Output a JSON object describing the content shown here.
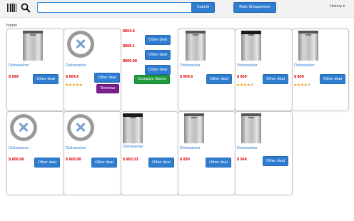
{
  "header": {
    "search_value": "",
    "submit_label": "Submit",
    "rate_label": "Rate Shoppertore",
    "history_label": "History",
    "icons": [
      "barcode-icon",
      "search-icon",
      "chevron-down-icon"
    ]
  },
  "found_label": "found:",
  "row1": [
    {
      "name": "Dishwasher",
      "price": "$ 699",
      "deal": "Other deal"
    },
    {
      "name": "Dishwasher",
      "price": "$ 804.6",
      "deal": "Other deal",
      "reviews": "Reviews",
      "stores": [
        {
          "price": "$804.6",
          "deal": "Other deal"
        },
        {
          "price": "$809.1",
          "deal": "Other deal"
        },
        {
          "price": "$809.98",
          "deal": "Other deal"
        }
      ],
      "compare": "Compare Stores"
    },
    {
      "name": "Dishwasher",
      "price": "$ 804.6",
      "deal": "Other deal"
    },
    {
      "name": "Dishwasher",
      "price": "$ 809",
      "deal": "Other deal"
    },
    {
      "name": "Dishwasher",
      "price": "$ 809",
      "deal": "Other deal"
    }
  ],
  "row2": [
    {
      "name": "Dishwasher",
      "price": "$ 809.98",
      "deal": "Other deal"
    },
    {
      "name": "Dishwasher",
      "price": "$ 809.98",
      "deal": "Other deal"
    },
    {
      "name": "Dishwasher",
      "price": "$ 850.33",
      "deal": "Other deal"
    },
    {
      "name": "Dishwasher",
      "price": "$ 899",
      "deal": "Other deal"
    },
    {
      "name": "Dishwasher",
      "price": "$ 949",
      "deal": "Other deal"
    }
  ],
  "ratings": {
    "row1_card2": 5,
    "row1_card4": 4,
    "row1_card5": 4
  },
  "colors": {
    "accent": "#2f7dd1",
    "price": "#e00000",
    "reviews": "#7b1d8f",
    "compare": "#1f9b3f"
  }
}
